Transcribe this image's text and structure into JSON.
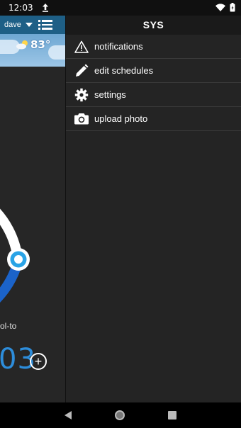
{
  "status_bar": {
    "time": "12:03",
    "icons": [
      "upload-icon",
      "wifi-icon",
      "battery-icon"
    ]
  },
  "background_app": {
    "user": "dave",
    "weather_temp": "83°",
    "mode_label": "ol-to",
    "temp_value": "03",
    "plus_label": "+"
  },
  "drawer": {
    "title": "SYS",
    "items": [
      {
        "label": "notifications",
        "icon": "warning-icon"
      },
      {
        "label": "edit schedules",
        "icon": "pencil-icon"
      },
      {
        "label": "settings",
        "icon": "gear-icon"
      },
      {
        "label": "upload photo",
        "icon": "camera-icon"
      }
    ]
  },
  "nav_bar": {
    "buttons": [
      "back-icon",
      "home-icon",
      "recents-icon"
    ]
  },
  "colors": {
    "accent_blue": "#2d8ddb",
    "topbar_blue": "#1e5f86",
    "drawer_bg": "#242424"
  }
}
